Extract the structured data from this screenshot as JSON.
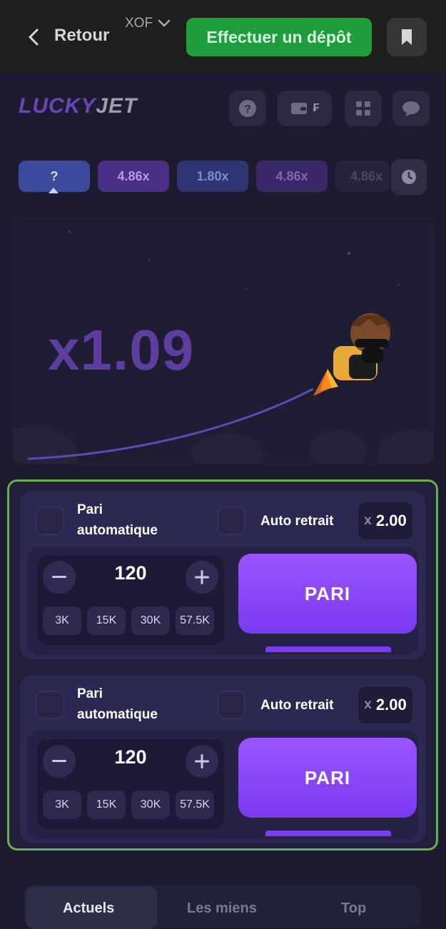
{
  "topbar": {
    "back_label": "Retour",
    "currency": "XOF",
    "deposit_label": "Effectuer un dépôt"
  },
  "game": {
    "logo_part1": "LUCKY",
    "logo_part2": "JET",
    "wallet_label": "₣",
    "history": [
      "?",
      "4.86x",
      "1.80x",
      "4.86x",
      "4.86x"
    ],
    "multiplier": "x1.09"
  },
  "bets": [
    {
      "auto_bet_label_1": "Pari",
      "auto_bet_label_2": "automatique",
      "auto_cashout_label": "Auto retrait",
      "auto_cashout_prefix": "x",
      "auto_cashout_value": "2.00",
      "stake": "120",
      "chips": [
        "3K",
        "15K",
        "30K",
        "57.5K"
      ],
      "bet_label": "PARI"
    },
    {
      "auto_bet_label_1": "Pari",
      "auto_bet_label_2": "automatique",
      "auto_cashout_label": "Auto retrait",
      "auto_cashout_prefix": "x",
      "auto_cashout_value": "2.00",
      "stake": "120",
      "chips": [
        "3K",
        "15K",
        "30K",
        "57.5K"
      ],
      "bet_label": "PARI"
    }
  ],
  "tabs": [
    "Actuels",
    "Les miens",
    "Top"
  ],
  "icons": [
    "chevron-left-icon",
    "chevron-down-icon",
    "bookmark-icon",
    "help-icon",
    "wallet-icon",
    "grid-icon",
    "chat-icon",
    "clock-icon",
    "minus-icon",
    "plus-icon"
  ]
}
